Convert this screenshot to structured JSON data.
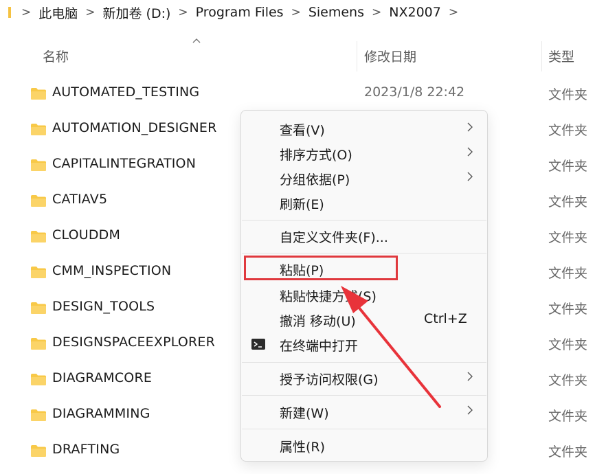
{
  "breadcrumb": {
    "segments": [
      "此电脑",
      "新加卷 (D:)",
      "Program Files",
      "Siemens",
      "NX2007"
    ]
  },
  "columns": {
    "name": "名称",
    "date": "修改日期",
    "type": "类型"
  },
  "files": [
    {
      "name": "AUTOMATED_TESTING",
      "date": "2023/1/8 22:42",
      "type": "文件夹"
    },
    {
      "name": "AUTOMATION_DESIGNER",
      "date": "",
      "type": "文件夹"
    },
    {
      "name": "CAPITALINTEGRATION",
      "date": "",
      "type": "文件夹"
    },
    {
      "name": "CATIAV5",
      "date": "",
      "type": "文件夹"
    },
    {
      "name": "CLOUDDM",
      "date": "",
      "type": "文件夹"
    },
    {
      "name": "CMM_INSPECTION",
      "date": "",
      "type": "文件夹"
    },
    {
      "name": "DESIGN_TOOLS",
      "date": "",
      "type": "文件夹"
    },
    {
      "name": "DESIGNSPACEEXPLORER",
      "date": "",
      "type": "文件夹"
    },
    {
      "name": "DIAGRAMCORE",
      "date": "",
      "type": "文件夹"
    },
    {
      "name": "DIAGRAMMING",
      "date": "",
      "type": "文件夹"
    },
    {
      "name": "DRAFTING",
      "date": "",
      "type": "文件夹"
    }
  ],
  "context_menu": {
    "view": "查看(V)",
    "sort_by": "排序方式(O)",
    "group_by": "分组依据(P)",
    "refresh": "刷新(E)",
    "customize_folder": "自定义文件夹(F)...",
    "paste": "粘贴(P)",
    "paste_shortcut": "粘贴快捷方式(S)",
    "undo_move": "撤消 移动(U)",
    "undo_shortcut": "Ctrl+Z",
    "open_terminal": "在终端中打开",
    "grant_access": "授予访问权限(G)",
    "new": "新建(W)",
    "properties": "属性(R)"
  },
  "colors": {
    "folder": "#f8c948",
    "highlight": "#e0393e",
    "arrow": "#e8333a"
  }
}
